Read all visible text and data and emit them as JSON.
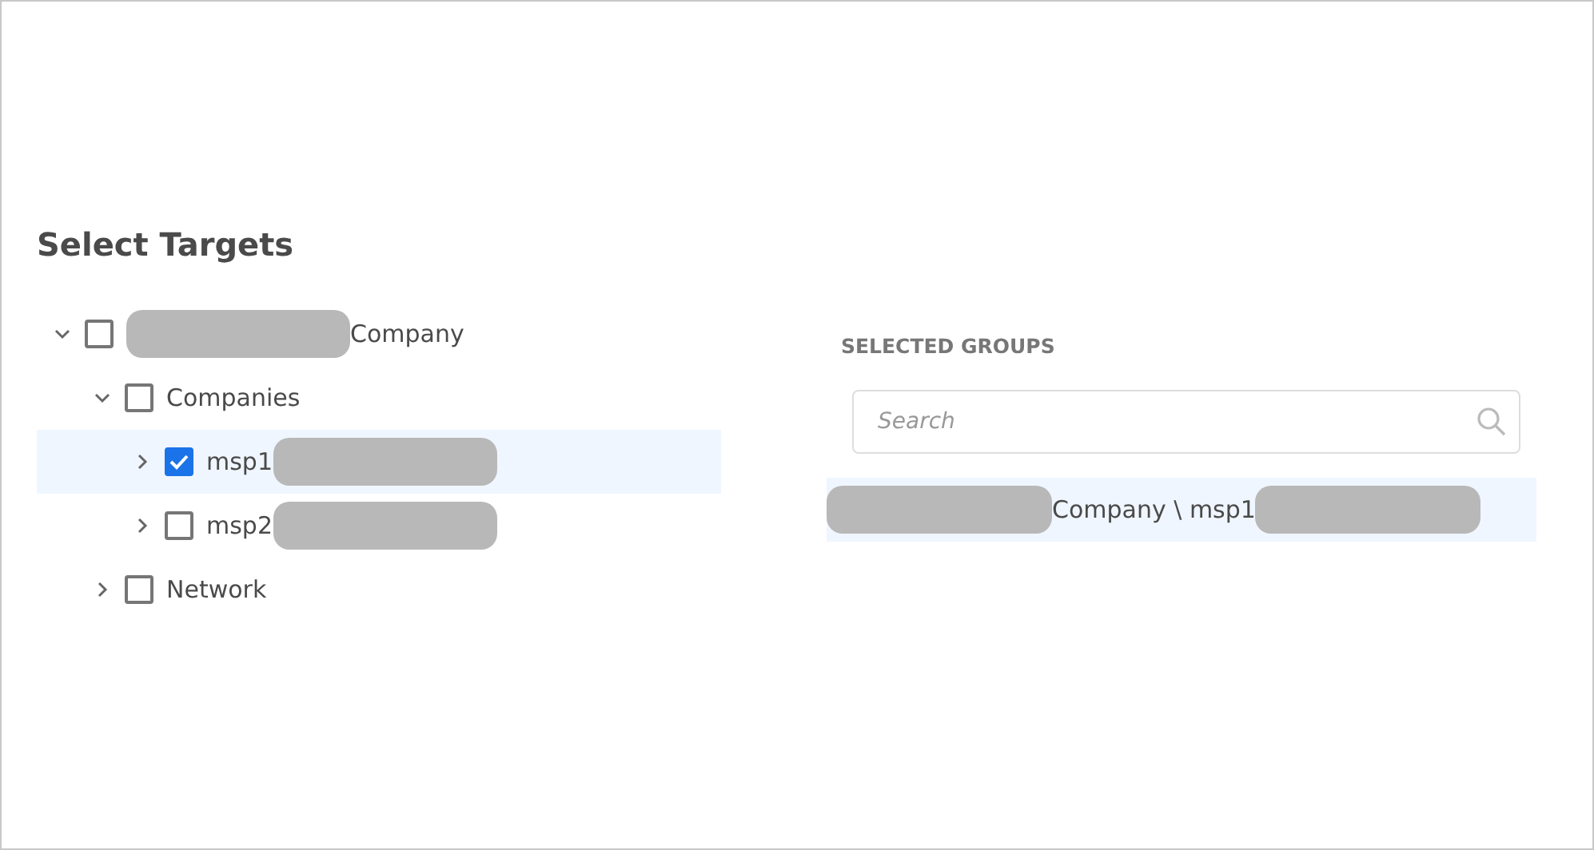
{
  "title": "Select Targets",
  "tree": [
    {
      "label": "Company",
      "redacted_before": true,
      "checked": false,
      "expanded": true,
      "selected": false,
      "children": [
        {
          "label": "Companies",
          "checked": false,
          "expanded": true,
          "selected": false,
          "children": [
            {
              "label": "msp1",
              "redacted_after": true,
              "checked": true,
              "expanded": false,
              "selected": true
            },
            {
              "label": "msp2",
              "redacted_after": true,
              "checked": false,
              "expanded": false,
              "selected": false
            }
          ]
        },
        {
          "label": "Network",
          "checked": false,
          "expanded": false,
          "selected": false
        }
      ]
    }
  ],
  "selected_groups": {
    "heading": "SELECTED GROUPS",
    "search": {
      "placeholder": "Search"
    },
    "items": [
      {
        "label": "Company \\ msp1",
        "redacted_before": true,
        "redacted_after": true,
        "selected": true
      }
    ]
  }
}
